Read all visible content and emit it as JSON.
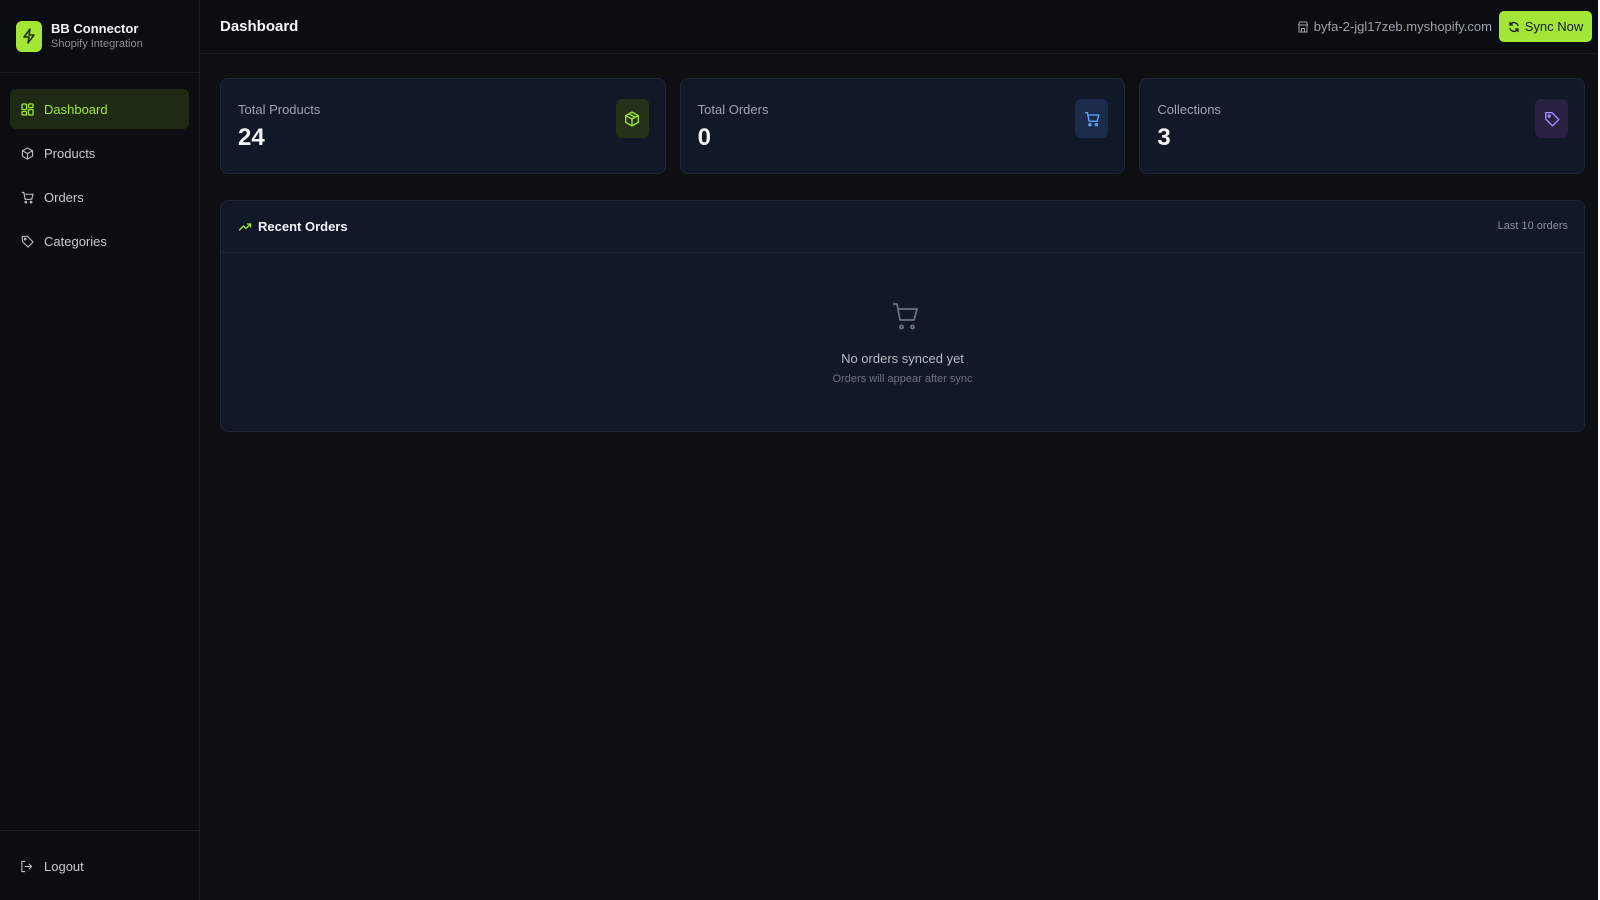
{
  "colors": {
    "accent": "#a3e635",
    "background": "#0d0f13",
    "card": "#111827",
    "products_icon_bg": "#233219",
    "orders_icon_bg": "#1c2b4a",
    "collections_icon_bg": "#2a2042"
  },
  "brand": {
    "name": "BB Connector",
    "subtitle": "Shopify Integration",
    "icon": "lightning-icon"
  },
  "sidebar": {
    "items": [
      {
        "label": "Dashboard",
        "icon": "dashboard-grid-icon",
        "active": true
      },
      {
        "label": "Products",
        "icon": "box-icon",
        "active": false
      },
      {
        "label": "Orders",
        "icon": "cart-icon",
        "active": false
      },
      {
        "label": "Categories",
        "icon": "tag-icon",
        "active": false
      }
    ],
    "logout_label": "Logout"
  },
  "header": {
    "title": "Dashboard",
    "store_domain": "byfa-2-jgl17zeb.myshopify.com",
    "sync_label": "Sync Now"
  },
  "stats": [
    {
      "label": "Total Products",
      "value": "24",
      "icon": "box-icon"
    },
    {
      "label": "Total Orders",
      "value": "0",
      "icon": "cart-icon"
    },
    {
      "label": "Collections",
      "value": "3",
      "icon": "tag-icon"
    }
  ],
  "recent_orders": {
    "title": "Recent Orders",
    "meta": "Last 10 orders",
    "empty_title": "No orders synced yet",
    "empty_subtitle": "Orders will appear after sync"
  }
}
